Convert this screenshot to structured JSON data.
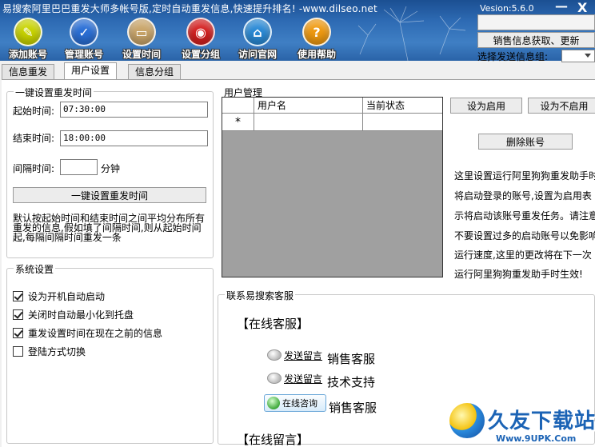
{
  "window": {
    "title": "易搜索阿里巴巴重发大师多帐号版,定时自动重发信息,快速提升排名! -www.dilseo.net",
    "version": "Vesion:5.6.0",
    "minimize": "—",
    "close": "X"
  },
  "toolbar": [
    {
      "label": "添加账号",
      "icon": "add-account-icon",
      "glyph": "✎",
      "color": "#c9d400"
    },
    {
      "label": "管理账号",
      "icon": "manage-account-icon",
      "glyph": "✓",
      "color": "#2a6fd6"
    },
    {
      "label": "设置时间",
      "icon": "set-time-icon",
      "glyph": "▭",
      "color": "#c9a56a"
    },
    {
      "label": "设置分组",
      "icon": "set-group-icon",
      "glyph": "◉",
      "color": "#d42020"
    },
    {
      "label": "访问官网",
      "icon": "home-icon",
      "glyph": "⌂",
      "color": "#2a8ad6"
    },
    {
      "label": "使用帮助",
      "icon": "help-icon",
      "glyph": "?",
      "color": "#f09a10"
    }
  ],
  "right_panel": {
    "fetch_button": "销售信息获取、更新",
    "group_label": "选择发送信息组:",
    "group_value": ""
  },
  "tabs": [
    "信息重发",
    "用户设置",
    "信息分组"
  ],
  "active_tab": "用户设置",
  "resend": {
    "legend": "一键设置重发时间",
    "start_label": "起始时间:",
    "start_value": "07:30:00",
    "end_label": "结束时间:",
    "end_value": "18:00:00",
    "interval_label": "间隔时间:",
    "interval_value": "",
    "interval_unit": "分钟",
    "button": "一键设置重发时间",
    "description": "默认按起始时间和结束时间之间平均分布所有重发的信息,假如填了间隔时间,则从起始时间起,每隔间隔时间重发一条"
  },
  "system": {
    "legend": "系统设置",
    "options": [
      {
        "label": "设为开机自动启动",
        "checked": true
      },
      {
        "label": "关闭时自动最小化到托盘",
        "checked": true
      },
      {
        "label": "重发设置时间在现在之前的信息",
        "checked": true
      },
      {
        "label": "登陆方式切换",
        "checked": false
      }
    ]
  },
  "user_mgmt": {
    "legend": "用户管理",
    "columns": [
      "用户名",
      "当前状态"
    ],
    "new_row_marker": "*",
    "enable_button": "设为启用",
    "disable_button": "设为不启用",
    "delete_button": "删除账号",
    "info_lines": [
      "这里设置运行阿里狗狗重发助手时",
      "将启动登录的账号,设置为启用表",
      "示将启动该账号重发任务。请注意",
      "不要设置过多的启动账号以免影响",
      "运行速度,这里的更改将在下一次",
      "运行阿里狗狗重发助手时生效!"
    ]
  },
  "service": {
    "legend": "联系易搜索客服",
    "online_header": "【在线客服】",
    "rows": [
      {
        "link": "发送留言",
        "text": "销售客服"
      },
      {
        "link": "发送留言",
        "text": "技术支持"
      }
    ],
    "consult_button": "在线咨询",
    "consult_text": "销售客服",
    "leave_msg_header": "【在线留言】"
  },
  "watermark": {
    "title": "久友下载站",
    "url": "Www.9UPK.Com"
  }
}
